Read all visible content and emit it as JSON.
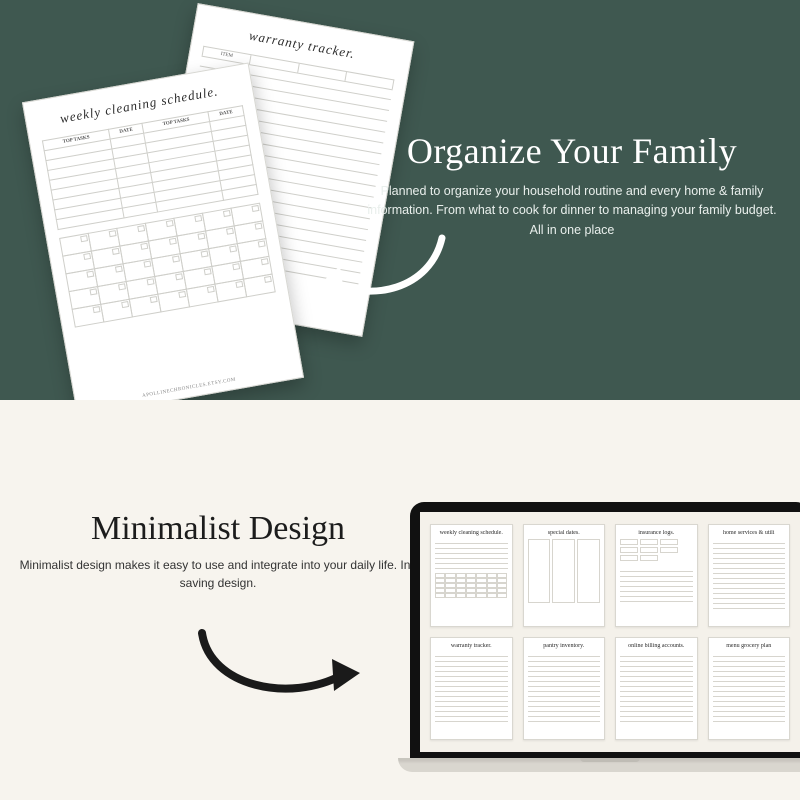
{
  "colors": {
    "top_bg": "#3f5850",
    "bottom_bg": "#f7f4ee"
  },
  "top": {
    "heading": "Organize Your Family",
    "body": "Planned to organize your household routine and every home & family information. From what to cook for dinner to managing your family budget. All in one place"
  },
  "sheets": {
    "back": {
      "title": "warranty tracker.",
      "header_cells": [
        "ITEM",
        "",
        "",
        ""
      ]
    },
    "front": {
      "title": "weekly cleaning schedule.",
      "task_headers": [
        "TOP TASKS",
        "DATE",
        "TOP TASKS",
        "DATE"
      ],
      "footer": "APOLLINECHRONICLES.ETSY.COM"
    }
  },
  "bottom": {
    "heading": "Minimalist Design",
    "body": "Minimalist design makes it easy to use and integrate into your daily life. Ink saving design."
  },
  "laptop_thumbs": [
    {
      "title": "weekly cleaning schedule."
    },
    {
      "title": "special dates."
    },
    {
      "title": "insurance logs."
    },
    {
      "title": "home services & utili"
    },
    {
      "title": "warranty tracker."
    },
    {
      "title": "pantry inventory."
    },
    {
      "title": "online billing accounts."
    },
    {
      "title": "menu grocery plan"
    }
  ]
}
